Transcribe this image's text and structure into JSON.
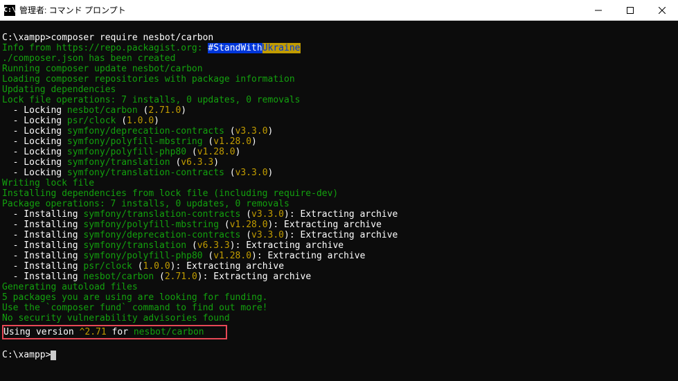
{
  "window": {
    "title": "管理者: コマンド プロンプト",
    "icon_text": "C:\\"
  },
  "prompt1": {
    "path": "C:\\xampp>",
    "command": "composer require nesbot/carbon"
  },
  "lines": {
    "info_from": "Info from https://repo.packagist.org: ",
    "stand_with": "#StandWith",
    "ukraine": "Ukraine",
    "composer_created": "./composer.json has been created",
    "running_update": "Running composer update nesbot/carbon",
    "loading_repos": "Loading composer repositories with package information",
    "updating_deps": "Updating dependencies",
    "lock_ops": "Lock file operations: 7 installs, 0 updates, 0 removals",
    "lock1_pre": "  - Locking ",
    "lock1_pkg": "nesbot/carbon",
    "lock1_ver_open": " (",
    "lock1_ver": "2.71.0",
    "lock1_ver_close": ")",
    "lock2_pre": "  - Locking ",
    "lock2_pkg": "psr/clock",
    "lock2_ver": "1.0.0",
    "lock3_pre": "  - Locking ",
    "lock3_pkg": "symfony/deprecation-contracts",
    "lock3_ver": "v3.3.0",
    "lock4_pre": "  - Locking ",
    "lock4_pkg": "symfony/polyfill-mbstring",
    "lock4_ver": "v1.28.0",
    "lock5_pre": "  - Locking ",
    "lock5_pkg": "symfony/polyfill-php80",
    "lock5_ver": "v1.28.0",
    "lock6_pre": "  - Locking ",
    "lock6_pkg": "symfony/translation",
    "lock6_ver": "v6.3.3",
    "lock7_pre": "  - Locking ",
    "lock7_pkg": "symfony/translation-contracts",
    "lock7_ver": "v3.3.0",
    "writing_lock": "Writing lock file",
    "installing_deps": "Installing dependencies from lock file (including require-dev)",
    "pkg_ops": "Package operations: 7 installs, 0 updates, 0 removals",
    "inst1_pre": "  - Installing ",
    "inst1_pkg": "symfony/translation-contracts",
    "inst1_ver": "v3.3.0",
    "inst1_post": "): Extracting archive",
    "inst2_pkg": "symfony/polyfill-mbstring",
    "inst2_ver": "v1.28.0",
    "inst3_pkg": "symfony/deprecation-contracts",
    "inst3_ver": "v3.3.0",
    "inst4_pkg": "symfony/translation",
    "inst4_ver": "v6.3.3",
    "inst5_pkg": "symfony/polyfill-php80",
    "inst5_ver": "v1.28.0",
    "inst6_pkg": "psr/clock",
    "inst6_ver": "1.0.0",
    "inst7_pkg": "nesbot/carbon",
    "inst7_ver": "2.71.0",
    "gen_autoload": "Generating autoload files",
    "pkg_funding": "5 packages you are using are looking for funding.",
    "use_fund": "Use the `composer fund` command to find out more!",
    "no_vuln": "No security vulnerability advisories found",
    "using_version_pre": "Using version ",
    "using_version_ver": "^2.71",
    "using_version_for": " for ",
    "using_version_pkg": "nesbot/carbon"
  },
  "prompt2": {
    "path": "C:\\xampp>"
  }
}
